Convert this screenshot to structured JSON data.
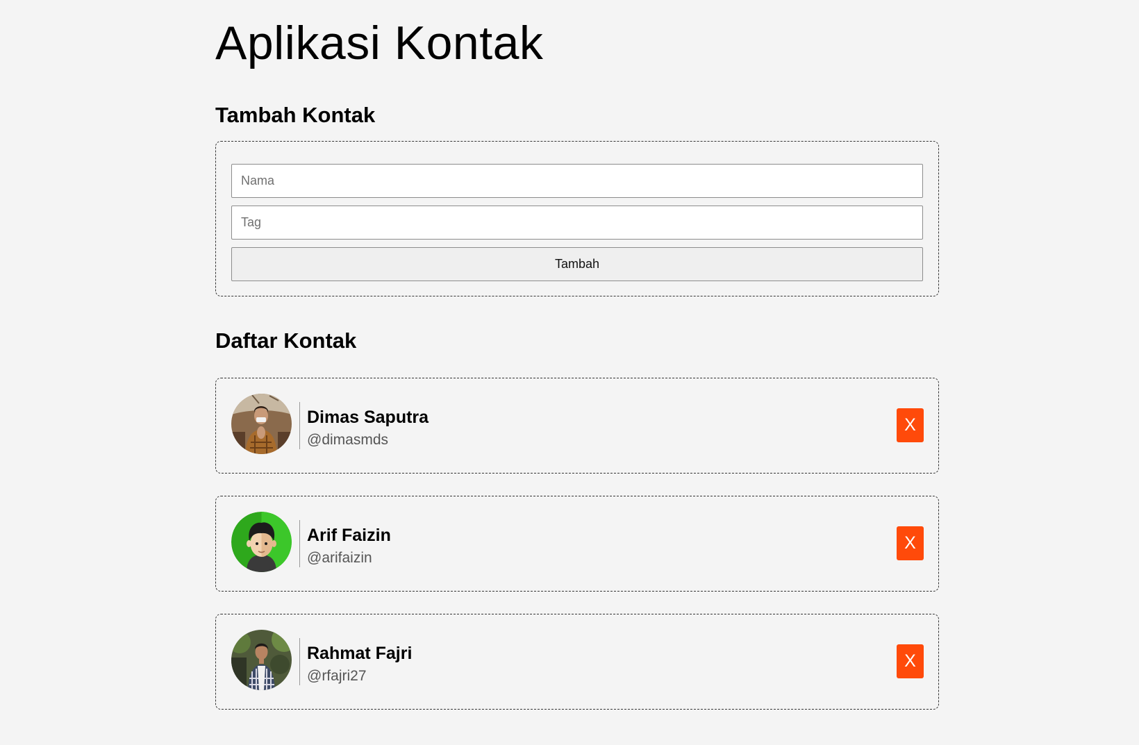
{
  "app": {
    "title": "Aplikasi Kontak"
  },
  "add_section": {
    "title": "Tambah Kontak",
    "name_placeholder": "Nama",
    "name_value": "",
    "tag_placeholder": "Tag",
    "tag_value": "",
    "submit_label": "Tambah"
  },
  "list_section": {
    "title": "Daftar Kontak",
    "contacts": [
      {
        "name": "Dimas Saputra",
        "tag": "@dimasmds",
        "avatar": "photo-avatar-man-praying-hands",
        "delete_label": "X"
      },
      {
        "name": "Arif Faizin",
        "tag": "@arifaizin",
        "avatar": "cartoon-avatar-green-background",
        "delete_label": "X"
      },
      {
        "name": "Rahmat Fajri",
        "tag": "@rfajri27",
        "avatar": "photo-avatar-man-outdoor",
        "delete_label": "X"
      }
    ]
  },
  "colors": {
    "background": "#f4f4f4",
    "delete_button": "#ff4a0a",
    "card_border": "#333333"
  }
}
